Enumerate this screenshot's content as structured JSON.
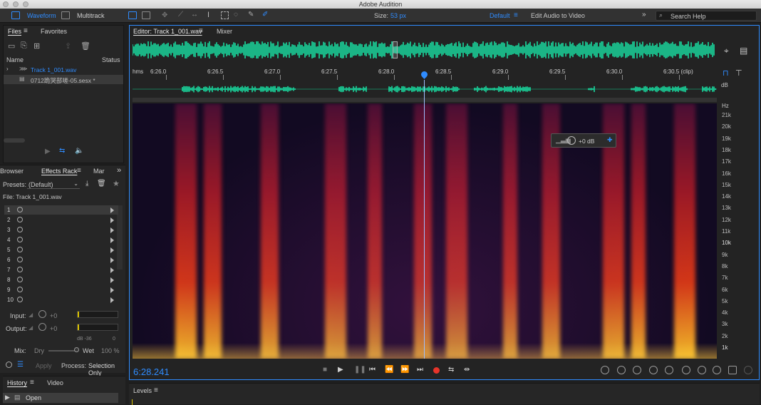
{
  "app": {
    "title": "Adobe Audition"
  },
  "toolbar": {
    "waveform_label": "Waveform",
    "multitrack_label": "Multitrack",
    "size_label": "Size:",
    "size_value": "53 px",
    "workspace": "Default",
    "workspace_alt": "Edit Audio to Video",
    "search_placeholder": "Search Help"
  },
  "files_panel": {
    "tabs": [
      "Files",
      "Favorites"
    ],
    "col_name": "Name",
    "col_status": "Status",
    "items": [
      {
        "name": "Track 1_001.wav",
        "color": "#2f8cff"
      },
      {
        "name": "0712跪哭部嗟-05.sesx *",
        "color": "#bdbdbd"
      }
    ]
  },
  "effects_panel": {
    "tabs": [
      "Browser",
      "Effects Rack",
      "Mar"
    ],
    "presets_label": "Presets:",
    "presets_value": "(Default)",
    "file_label": "File: Track 1_001.wav",
    "slots": [
      "1",
      "2",
      "3",
      "4",
      "5",
      "6",
      "7",
      "8",
      "9",
      "10"
    ],
    "input_label": "Input:",
    "input_value": "+0",
    "output_label": "Output:",
    "output_value": "+0",
    "meter_scale": [
      "dB -36",
      "0"
    ],
    "mix_label": "Mix:",
    "mix_dry": "Dry",
    "mix_wet": "Wet",
    "mix_percent": "100 %",
    "apply_label": "Apply",
    "process_label": "Process:",
    "process_value": "Selection Only"
  },
  "history_panel": {
    "tabs": [
      "History",
      "Video"
    ],
    "items": [
      "Open"
    ]
  },
  "editor": {
    "tab_label": "Editor: Track 1_001.wav",
    "mixer_label": "Mixer",
    "ruler_unit": "hms",
    "ruler_ticks": [
      "6:26.0",
      "6:26.5",
      "6:27.0",
      "6:27.5",
      "6:28.0",
      "6:28.5",
      "6:29.0",
      "6:29.5",
      "6:30.0",
      "6:30.5 (clip)"
    ],
    "db_label": "dB",
    "hz_label": "Hz",
    "freq_labels": [
      "21k",
      "20k",
      "19k",
      "18k",
      "17k",
      "16k",
      "15k",
      "14k",
      "13k",
      "12k",
      "11k",
      "10k",
      "9k",
      "8k",
      "7k",
      "6k",
      "5k",
      "4k",
      "3k",
      "2k",
      "1k"
    ],
    "hud_value": "+0 dB",
    "current_time": "6:28.241",
    "playhead_position": 0.51
  },
  "levels_panel": {
    "label": "Levels"
  },
  "colors": {
    "accent": "#2f8cff",
    "waveform": "#19e6a8",
    "record": "#e8342a"
  }
}
